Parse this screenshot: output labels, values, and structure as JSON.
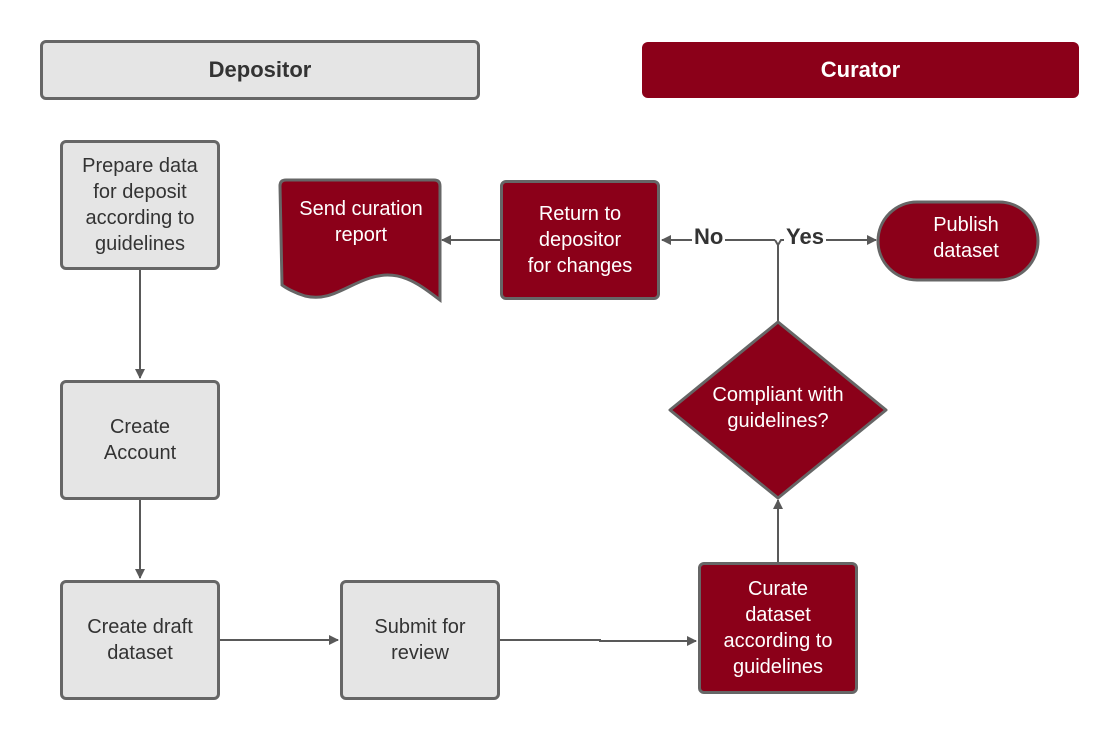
{
  "lanes": {
    "depositor": "Depositor",
    "curator": "Curator"
  },
  "colors": {
    "depositor_fill": "#e5e5e5",
    "curator_fill": "#8b0019",
    "stroke": "#666666",
    "text_dark": "#333333",
    "text_light": "#ffffff"
  },
  "nodes": {
    "prepare": "Prepare data\nfor deposit\naccording to\nguidelines",
    "create_account": "Create\nAccount",
    "create_draft": "Create draft\ndataset",
    "submit": "Submit for\nreview",
    "curate": "Curate\ndataset\naccording to\nguidelines",
    "compliant": "Compliant with\nguidelines?",
    "return": "Return to\ndepositor\nfor changes",
    "send_report": "Send curation\nreport",
    "publish": "Publish\ndataset"
  },
  "edge_labels": {
    "no": "No",
    "yes": "Yes"
  }
}
